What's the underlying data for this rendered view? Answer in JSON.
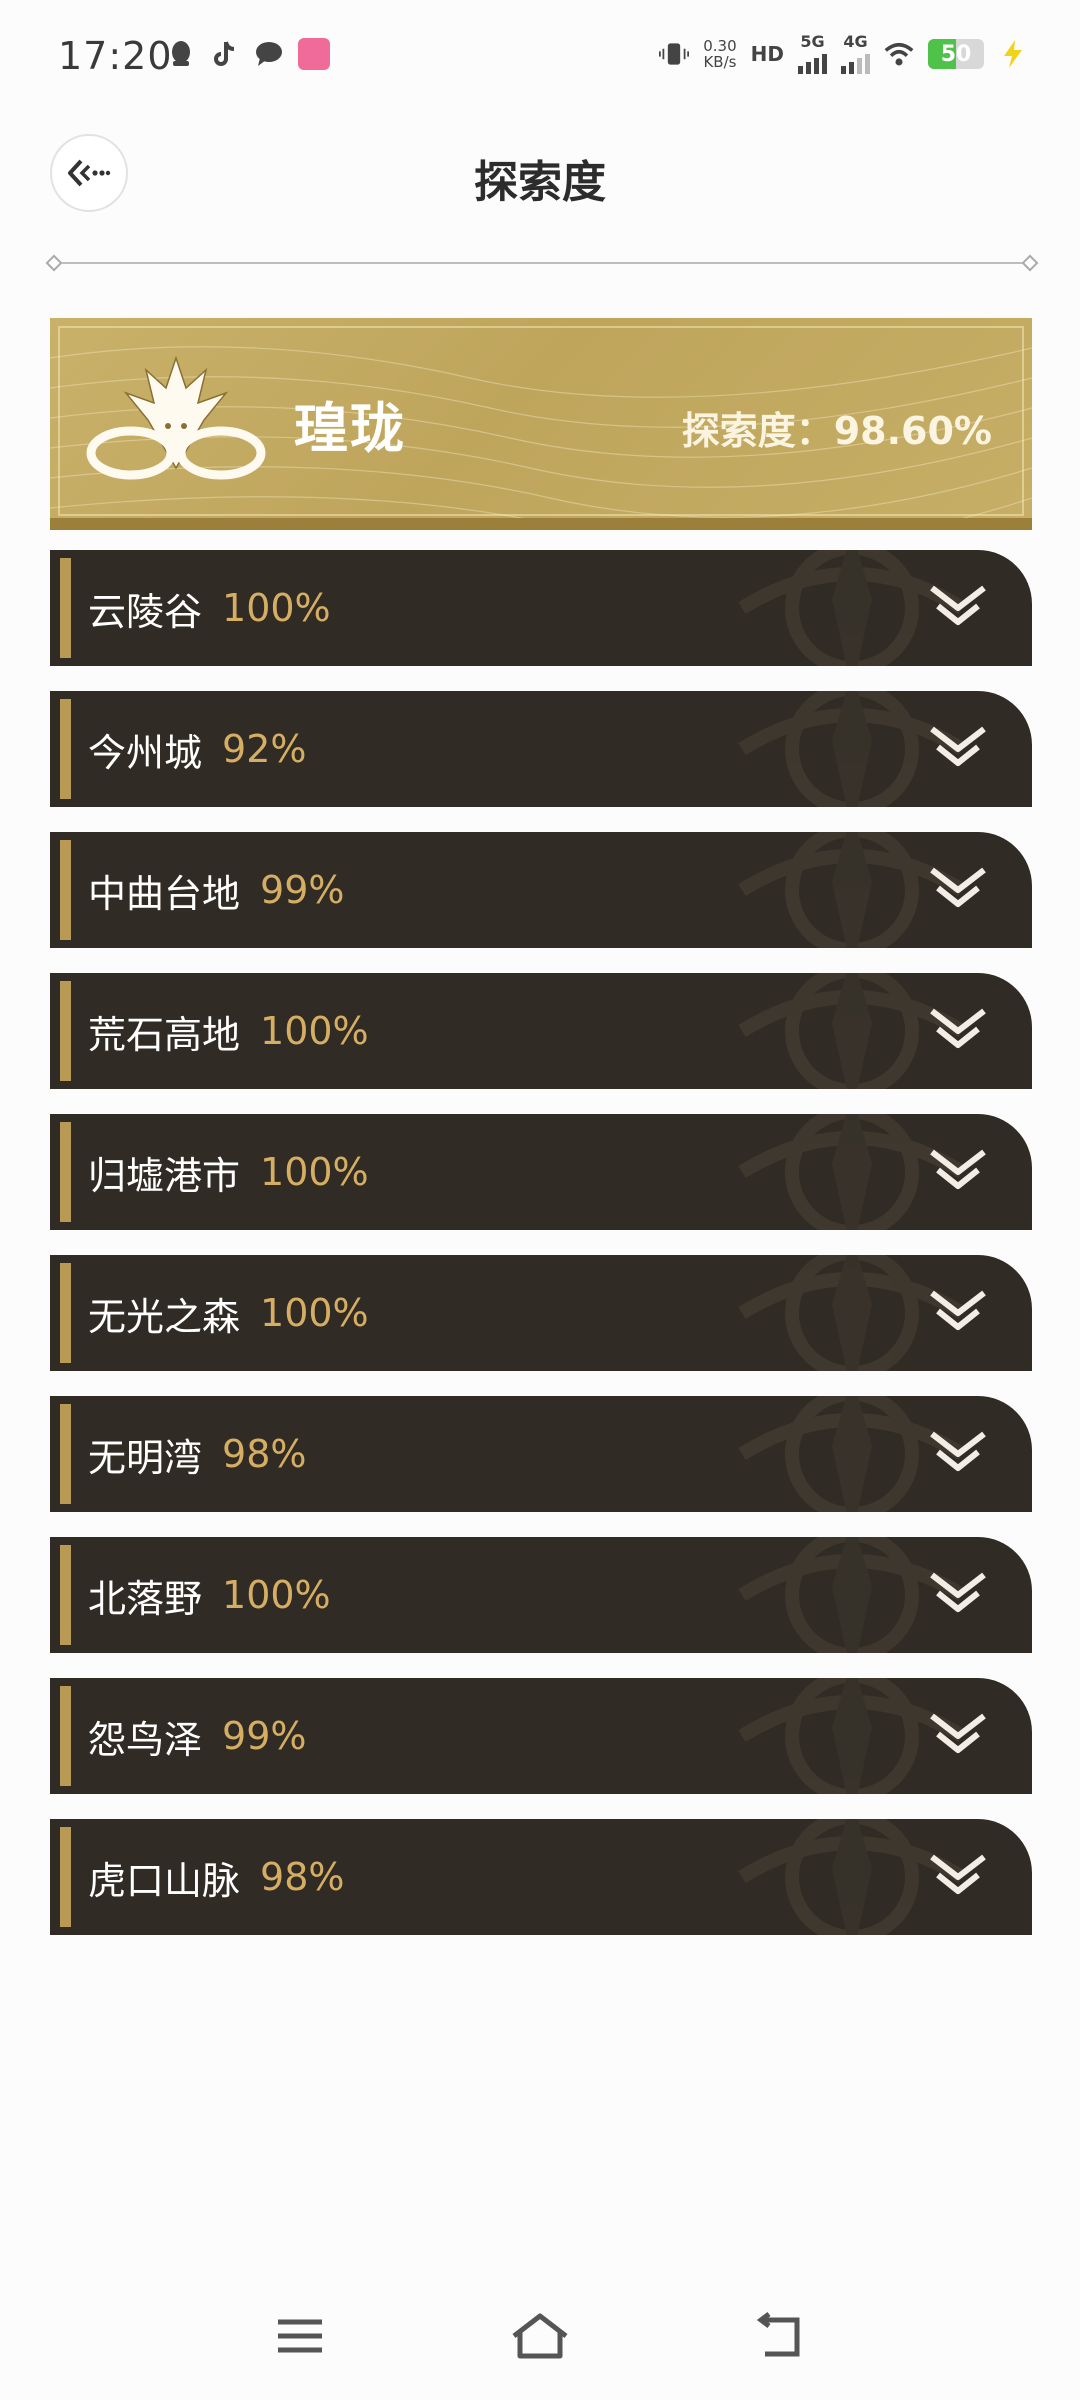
{
  "status_bar": {
    "time": "17:20",
    "net_speed": "0.30",
    "net_unit": "KB/s",
    "hd_label": "HD",
    "sim1_label": "5G",
    "sim2_label": "4G",
    "battery": "50",
    "icons": [
      "qq-icon",
      "tiktok-icon",
      "message-icon",
      "app-icon",
      "vibrate-icon",
      "wifi-icon",
      "charging-icon"
    ]
  },
  "header": {
    "title": "探索度"
  },
  "region": {
    "name": "瑝珑",
    "exploration_label": "探索度：",
    "exploration_value": "98.60%"
  },
  "areas": [
    {
      "name": "云陵谷",
      "percent": "100%"
    },
    {
      "name": "今州城",
      "percent": "92%"
    },
    {
      "name": "中曲台地",
      "percent": "99%"
    },
    {
      "name": "荒石高地",
      "percent": "100%"
    },
    {
      "name": "归墟港市",
      "percent": "100%"
    },
    {
      "name": "无光之森",
      "percent": "100%"
    },
    {
      "name": "无明湾",
      "percent": "98%"
    },
    {
      "name": "北落野",
      "percent": "100%"
    },
    {
      "name": "怨鸟泽",
      "percent": "99%"
    },
    {
      "name": "虎口山脉",
      "percent": "98%"
    }
  ],
  "colors": {
    "row_bg": "#302b24",
    "accent": "#b89a55",
    "percent": "#d6ae63",
    "banner": "#c2a860"
  }
}
